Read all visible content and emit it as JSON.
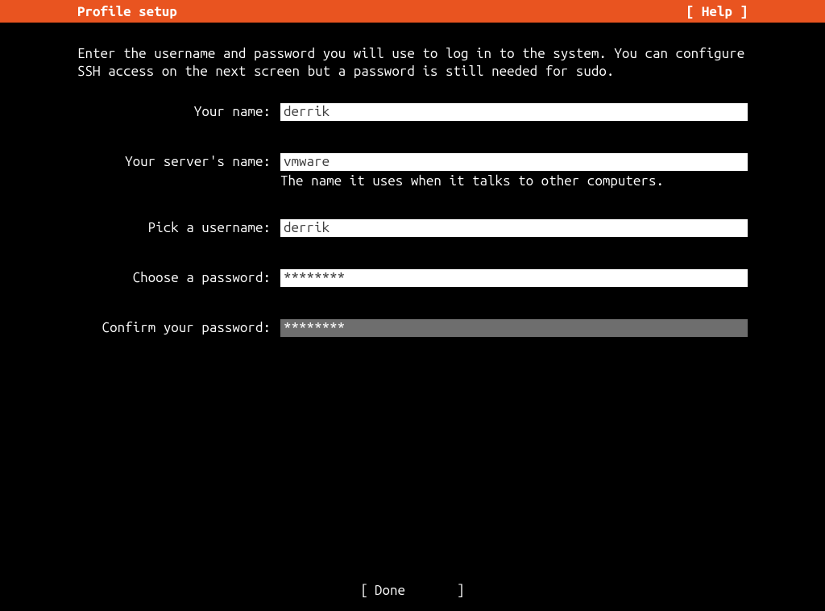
{
  "header": {
    "title": "Profile setup",
    "help_label": "[ Help ]"
  },
  "description": "Enter the username and password you will use to log in to the system. You can configure SSH access on the next screen but a password is still needed for sudo.",
  "form": {
    "your_name": {
      "label": "Your name:",
      "value": "derrik"
    },
    "server_name": {
      "label": "Your server's name:",
      "value": "vmware",
      "hint": "The name it uses when it talks to other computers."
    },
    "username": {
      "label": "Pick a username:",
      "value": "derrik"
    },
    "password": {
      "label": "Choose a password:",
      "value": "********"
    },
    "confirm_password": {
      "label": "Confirm your password:",
      "value": "********"
    }
  },
  "footer": {
    "done_label": "Done"
  }
}
